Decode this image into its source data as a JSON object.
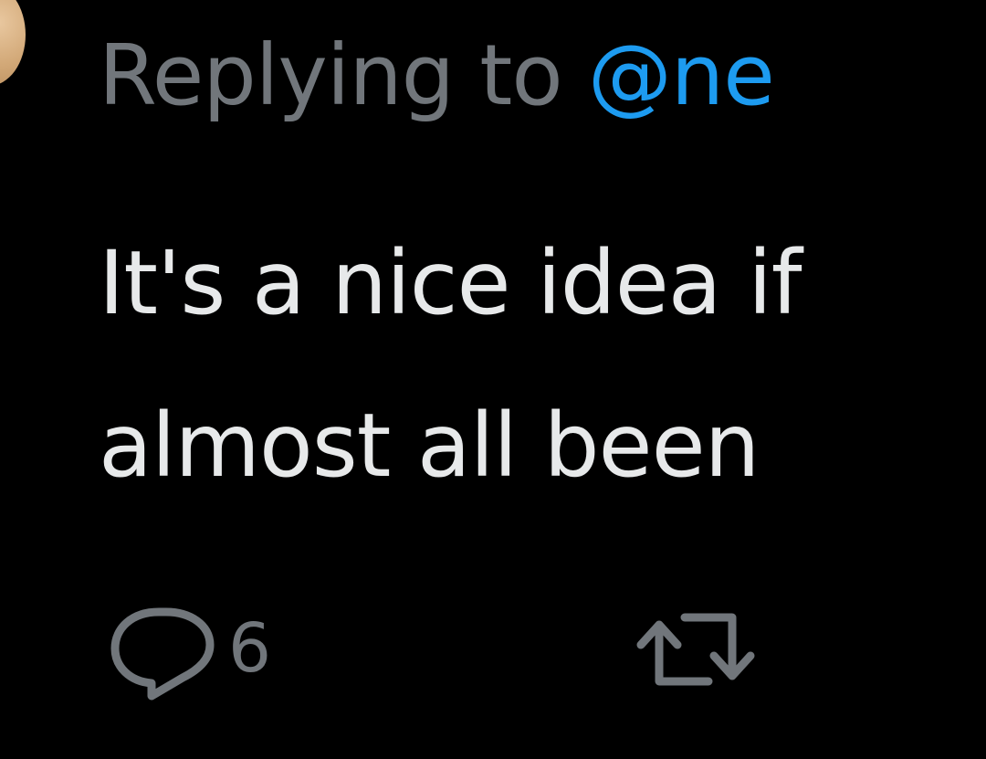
{
  "reply_header": {
    "prefix": "Replying to ",
    "handle": "@ne"
  },
  "tweet": {
    "lines": [
      "It's a nice idea if",
      "almost all been"
    ]
  },
  "actions": {
    "reply": {
      "icon": "reply-bubble-icon",
      "count": "6"
    },
    "retweet": {
      "icon": "retweet-icon"
    }
  },
  "colors": {
    "background": "#000000",
    "muted": "#71767b",
    "text": "#e7e9ea",
    "link": "#1d9bf0"
  }
}
